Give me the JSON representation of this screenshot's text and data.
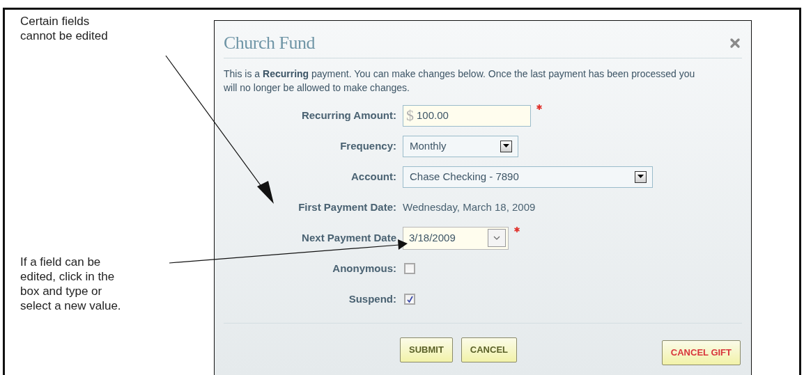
{
  "callouts": [
    {
      "text": "Certain fields cannot be edited"
    },
    {
      "text": "If a field can be edited, click in the box and type or select a new value."
    }
  ],
  "dialog": {
    "title": "Church Fund",
    "intro": "This is a **Recurring** payment. You can make changes below. Once the last payment has been processed you will no longer be allowed to make changes.",
    "fields": [
      {
        "kind": "amount",
        "label": "Recurring Amount:",
        "currency": "$",
        "value": "100.00",
        "required": true
      },
      {
        "kind": "dropdown",
        "label": "Frequency:",
        "value": "Monthly",
        "required": false
      },
      {
        "kind": "wide_dropdown",
        "label": "Account:",
        "value": "Chase Checking - 7890",
        "required": false
      },
      {
        "kind": "text",
        "label": "First Payment Date:",
        "value": "Wednesday, March 18, 2009"
      },
      {
        "kind": "date",
        "label": "Next Payment Date",
        "value": "3/18/2009",
        "required": true
      },
      {
        "kind": "checkbox",
        "label": "Anonymous:",
        "checked": false
      },
      {
        "kind": "checkbox",
        "label": "Suspend:",
        "checked": true
      }
    ],
    "buttons": [
      {
        "label": "SUBMIT",
        "kind": "primary"
      },
      {
        "label": "CANCEL",
        "kind": "primary"
      },
      {
        "label": "CANCEL GIFT",
        "kind": "danger"
      }
    ]
  }
}
